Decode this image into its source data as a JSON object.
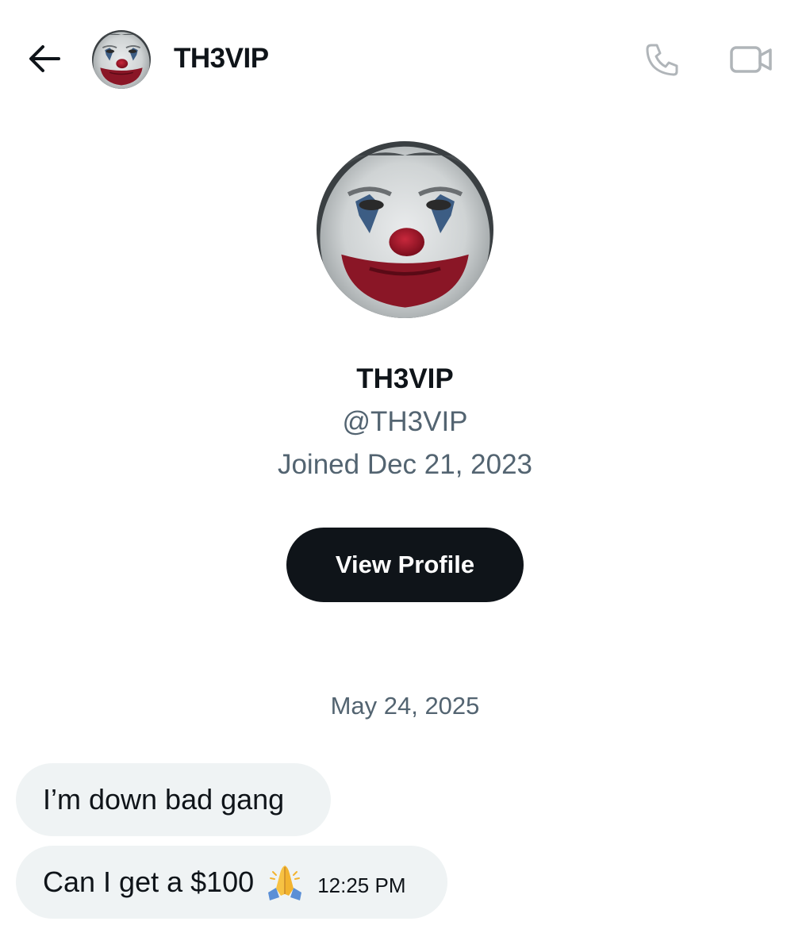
{
  "header": {
    "title": "TH3VIP",
    "back_icon": "arrow-left-icon",
    "call_icon": "phone-icon",
    "video_icon": "video-camera-icon"
  },
  "profile": {
    "name": "TH3VIP",
    "handle": "@TH3VIP",
    "joined": "Joined Dec 21, 2023",
    "view_profile_label": "View Profile"
  },
  "conversation": {
    "date": "May 24, 2025",
    "messages": [
      {
        "text": "I’m down bad gang"
      },
      {
        "text": "Can I get a $100",
        "emoji": "folded-hands-icon",
        "time": "12:25 PM"
      }
    ]
  },
  "colors": {
    "primary_text": "#0f1419",
    "secondary_text": "#536471",
    "bubble_bg": "#eff3f4",
    "button_bg": "#0f1419",
    "button_text": "#ffffff",
    "icon_gray": "#b0b5b9"
  }
}
